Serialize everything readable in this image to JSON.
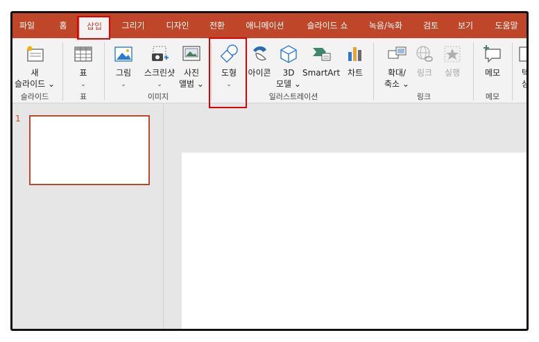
{
  "tabs": [
    "파일",
    "홈",
    "삽입",
    "그리기",
    "디자인",
    "전환",
    "애니메이션",
    "슬라이드 쇼",
    "녹음/녹화",
    "검토",
    "보기",
    "도움말"
  ],
  "active_tab": "삽입",
  "ribbon": {
    "new_slide": {
      "line1": "새",
      "line2": "슬라이드 ⌄"
    },
    "table": {
      "label": "표"
    },
    "picture": {
      "label": "그림"
    },
    "screenshot": {
      "label": "스크린샷"
    },
    "photo_album": {
      "line1": "사진",
      "line2": "앨범 ⌄"
    },
    "shapes": {
      "label": "도형"
    },
    "icons": {
      "label": "아이콘"
    },
    "models3d": {
      "line1": "3D",
      "line2": "모델 ⌄"
    },
    "smartart": {
      "label": "SmartArt"
    },
    "chart": {
      "label": "차트"
    },
    "zoom": {
      "line1": "확대/",
      "line2": "축소 ⌄"
    },
    "link": {
      "label": "링크"
    },
    "action": {
      "label": "실행"
    },
    "comment": {
      "label": "메모"
    },
    "text": {
      "line1": "텍",
      "line2": "상"
    },
    "caret": "⌄"
  },
  "groups": {
    "slides": "슬라이드",
    "table": "표",
    "images": "이미지",
    "illustrations": "일러스트레이션",
    "links": "링크",
    "comments": "메모"
  },
  "slide_number": "1",
  "colors": {
    "accent": "#c0462a",
    "highlight": "#e00000"
  }
}
